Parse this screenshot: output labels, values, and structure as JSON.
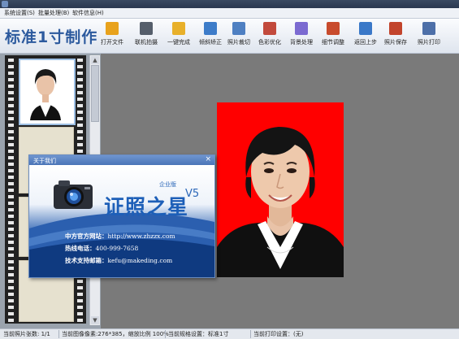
{
  "menu": [
    {
      "label": "系统设置(S)"
    },
    {
      "label": "批量处理(B)"
    },
    {
      "label": "软件信息(H)"
    }
  ],
  "app_title": "标准1寸制作",
  "toolbar": [
    {
      "label": "打开文件",
      "icon": "folder-open-icon",
      "color": "#e8a21c"
    },
    {
      "label": "联机拍摄",
      "icon": "camera-icon",
      "color": "#555e6b"
    },
    {
      "label": "一键完成",
      "icon": "wand-icon",
      "color": "#e8b02a"
    },
    {
      "label": "倾斜矫正",
      "icon": "rotate-icon",
      "color": "#3d7cc9"
    },
    {
      "label": "照片裁切",
      "icon": "crop-icon",
      "color": "#4f80c2"
    },
    {
      "label": "色彩优化",
      "icon": "palette-icon",
      "color": "#c24a3c"
    },
    {
      "label": "背景处理",
      "icon": "background-icon",
      "color": "#7b6ad1"
    },
    {
      "label": "细节调整",
      "icon": "adjust-icon",
      "color": "#c84b2d"
    },
    {
      "label": "返回上步",
      "icon": "undo-icon",
      "color": "#3a78c8"
    },
    {
      "label": "照片保存",
      "icon": "save-icon",
      "color": "#c2442c"
    },
    {
      "label": "照片打印",
      "icon": "printer-icon",
      "color": "#4d6fa8"
    }
  ],
  "dialog": {
    "title": "关于我们",
    "close": "×",
    "brand": "证照之星",
    "edition": "企业版",
    "version": "V5",
    "lines": [
      {
        "label": "中方官方网站：",
        "value": "http://www.zhzzx.com"
      },
      {
        "label": "热线电话：",
        "value": "400-999-7658"
      },
      {
        "label": "技术支持邮箱：",
        "value": "kefu@makeding.com"
      }
    ]
  },
  "status": [
    "当前照片张数: 1/1",
    "当前图像像素:276*385，缩放比例 100%",
    "当前规格设置：标准1寸",
    "当前打印设置：(无)"
  ],
  "colors": {
    "photo_background": "#ff0000",
    "brand_blue": "#1d5fb8"
  }
}
